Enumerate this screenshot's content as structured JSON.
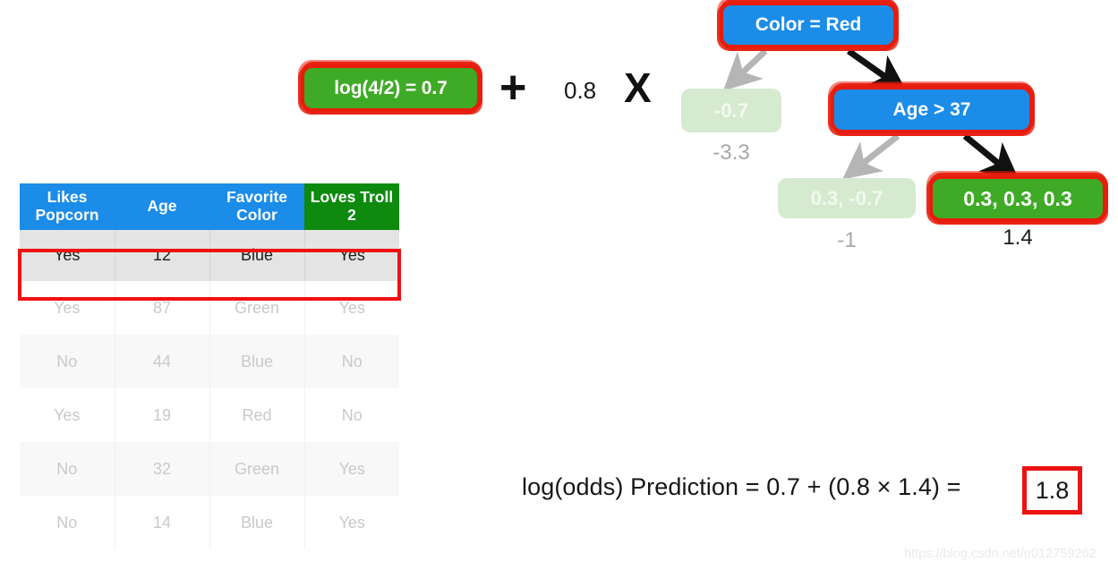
{
  "equation_top": {
    "log_box": "log(4/2) = 0.7",
    "plus": "+",
    "coefficient": "0.8",
    "times": "X"
  },
  "table": {
    "headers": [
      {
        "label": "Likes Popcorn",
        "color": "#1b8ce8"
      },
      {
        "label": "Age",
        "color": "#1b8ce8"
      },
      {
        "label": "Favorite Color",
        "color": "#1b8ce8"
      },
      {
        "label": "Loves Troll 2",
        "color": "#0e8a0e"
      }
    ],
    "rows": [
      {
        "likes_popcorn": "Yes",
        "age": "12",
        "favorite_color": "Blue",
        "loves_troll_2": "Yes",
        "highlighted": true
      },
      {
        "likes_popcorn": "Yes",
        "age": "87",
        "favorite_color": "Green",
        "loves_troll_2": "Yes",
        "highlighted": false
      },
      {
        "likes_popcorn": "No",
        "age": "44",
        "favorite_color": "Blue",
        "loves_troll_2": "No",
        "highlighted": false
      },
      {
        "likes_popcorn": "Yes",
        "age": "19",
        "favorite_color": "Red",
        "loves_troll_2": "No",
        "highlighted": false
      },
      {
        "likes_popcorn": "No",
        "age": "32",
        "favorite_color": "Green",
        "loves_troll_2": "Yes",
        "highlighted": false
      },
      {
        "likes_popcorn": "No",
        "age": "14",
        "favorite_color": "Blue",
        "loves_troll_2": "Yes",
        "highlighted": false
      }
    ]
  },
  "tree": {
    "root": {
      "label": "Color = Red",
      "highlighted": true
    },
    "internal": {
      "label": "Age > 37",
      "highlighted": true
    },
    "leaves": [
      {
        "label": "-0.7",
        "output": "-3.3",
        "highlighted": false
      },
      {
        "label": "0.3, -0.7",
        "output": "-1",
        "highlighted": false
      },
      {
        "label": "0.3, 0.3, 0.3",
        "output": "1.4",
        "highlighted": true
      }
    ],
    "edges": [
      {
        "from": "root",
        "to": "leaf--0.7",
        "active": false
      },
      {
        "from": "root",
        "to": "Age > 37",
        "active": true
      },
      {
        "from": "Age > 37",
        "to": "leaf-0.3,-0.7",
        "active": false
      },
      {
        "from": "Age > 37",
        "to": "leaf-0.3,0.3,0.3",
        "active": true
      }
    ]
  },
  "prediction": {
    "expression": "log(odds) Prediction = 0.7 + (0.8 × 1.4) =",
    "result": "1.8"
  },
  "watermark": "https://blog.csdn.net/u012759262",
  "colors": {
    "blue": "#1b8ce8",
    "dark_green": "#0e8a0e",
    "bright_green": "#3faa26",
    "light_green": "#d6ead0",
    "red_highlight": "#ee1111",
    "faded_text": "#c9c9c9",
    "arrow_active": "#111111",
    "arrow_inactive": "#b5b5b5"
  }
}
